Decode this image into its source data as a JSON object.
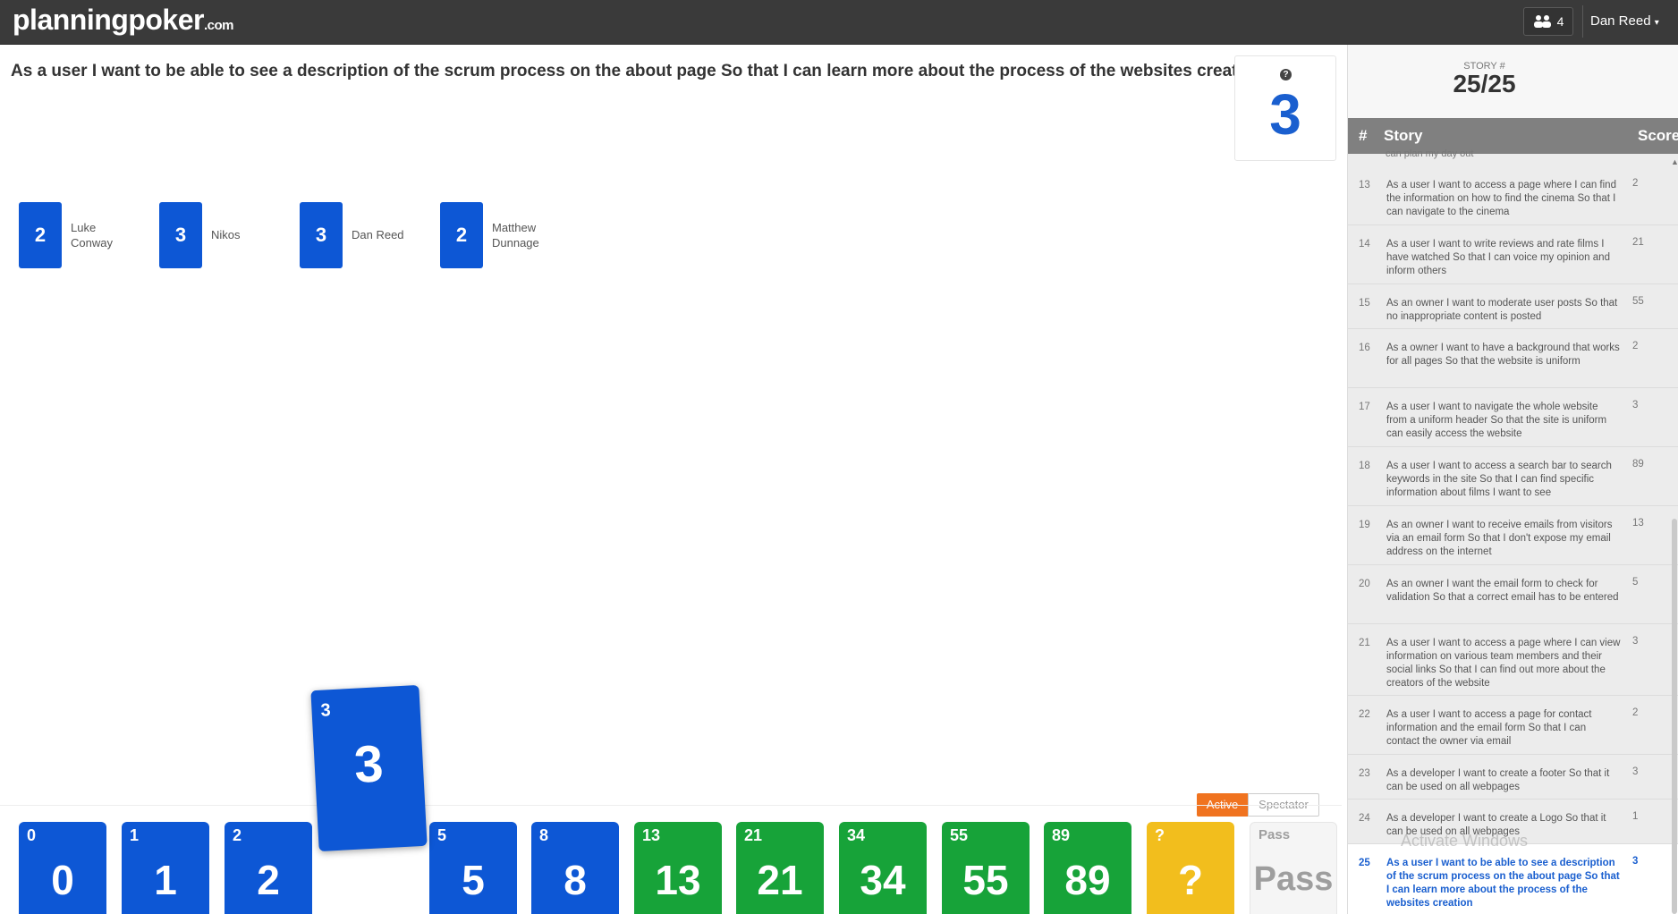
{
  "header": {
    "logo_main": "planningpoker",
    "logo_domain": ".com",
    "people_count": "4",
    "user_name": "Dan Reed",
    "people_icon": "users-icon",
    "chevron_icon": "chevron-down-icon"
  },
  "story": {
    "title": "As a user I want to be able to see a description of the scrum process on the about page So that I can learn more about the process of the websites creation",
    "average": "3"
  },
  "players": [
    {
      "name": "Luke Conway",
      "vote": "2"
    },
    {
      "name": "Nikos",
      "vote": "3"
    },
    {
      "name": "Dan Reed",
      "vote": "3"
    },
    {
      "name": "Matthew Dunnage",
      "vote": "2"
    }
  ],
  "selected_card": {
    "small": "3",
    "big": "3"
  },
  "cards": [
    {
      "small": "0",
      "big": "0"
    },
    {
      "small": "1",
      "big": "1"
    },
    {
      "small": "2",
      "big": "2"
    },
    {
      "small": "5",
      "big": "5"
    },
    {
      "small": "8",
      "big": "8"
    },
    {
      "small": "13",
      "big": "13"
    },
    {
      "small": "21",
      "big": "21"
    },
    {
      "small": "34",
      "big": "34"
    },
    {
      "small": "55",
      "big": "55"
    },
    {
      "small": "89",
      "big": "89"
    },
    {
      "small": "?",
      "big": "?"
    },
    {
      "small": "Pass",
      "big": "Pass"
    }
  ],
  "mode_toggle": {
    "active": "Active",
    "spectator": "Spectator"
  },
  "sidebar": {
    "story_label": "STORY #",
    "story_progress": "25/25",
    "col_num": "#",
    "col_story": "Story",
    "col_score": "Score",
    "partial_row": "can plan my day out",
    "rows": [
      {
        "num": "13",
        "text": "As a user I want to access a page where I can find the information on how to find the cinema So that I can navigate to the cinema",
        "score": "2"
      },
      {
        "num": "14",
        "text": "As a user I want to write reviews and rate films I have watched So that I can voice my opinion and inform others",
        "score": "21"
      },
      {
        "num": "15",
        "text": "As an owner I want to moderate user posts So that no inappropriate content is posted",
        "score": "55"
      },
      {
        "num": "16",
        "text": "As a owner I want to have a background that works for all pages So that the website is uniform",
        "score": "2"
      },
      {
        "num": "17",
        "text": "As a user I want to navigate the whole website from a uniform header So that the site is uniform can easily access the website",
        "score": "3"
      },
      {
        "num": "18",
        "text": "As a user I want to access a search bar to search keywords in the site So that I can find specific information about films I want to see",
        "score": "89"
      },
      {
        "num": "19",
        "text": "As an owner I want to receive emails from visitors via an email form So that I don't expose my email address on the internet",
        "score": "13"
      },
      {
        "num": "20",
        "text": "As an owner I want the email form to check for validation So that a correct email has to be entered",
        "score": "5"
      },
      {
        "num": "21",
        "text": "As a user I want to access a page where I can view information on various team members and their social links So that I can find out more about the creators of the website",
        "score": "3"
      },
      {
        "num": "22",
        "text": "As a user I want to access a page for contact information and the email form So that I can contact the owner via email",
        "score": "2"
      },
      {
        "num": "23",
        "text": "As a developer I want to create a footer So that it can be used on all webpages",
        "score": "3"
      },
      {
        "num": "24",
        "text": "As a developer I want to create a Logo So that it can be used on all webpages",
        "score": "1"
      },
      {
        "num": "25",
        "text": "As a user I want to be able to see a description of the scrum process on the about page So that I can learn more about the process of the websites creation",
        "score": "3"
      }
    ]
  },
  "watermark": "Activate Windows",
  "colors": {
    "card_blue": "#0d57d5",
    "card_green": "#17a339",
    "card_yellow": "#f2be1d",
    "active_orange": "#f0731f",
    "header_bg": "#3a3a3a"
  }
}
